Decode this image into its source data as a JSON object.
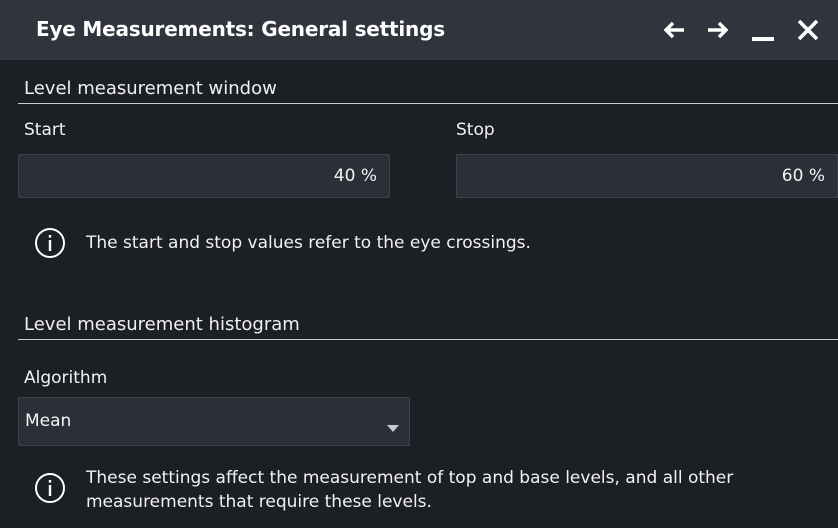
{
  "dialog": {
    "title": "Eye Measurements: General settings",
    "controls": [
      "back-arrow-icon",
      "forward-arrow-icon",
      "minimize-icon",
      "close-icon"
    ]
  },
  "level_window": {
    "section_title": "Level measurement window",
    "start_label": "Start",
    "start_value": "40 %",
    "stop_label": "Stop",
    "stop_value": "60 %",
    "info_text": "The start and stop values refer to the eye crossings."
  },
  "level_histogram": {
    "section_title": "Level measurement histogram",
    "algorithm_label": "Algorithm",
    "algorithm_value": "Mean",
    "info_text_line1": "These settings affect the measurement of top and base levels, and all other",
    "info_text_line2": "measurements that require these levels."
  },
  "colors": {
    "background": "#1c1f24",
    "titlebar": "#30353d",
    "field": "#2b3038",
    "rule": "#c9ccd1"
  }
}
